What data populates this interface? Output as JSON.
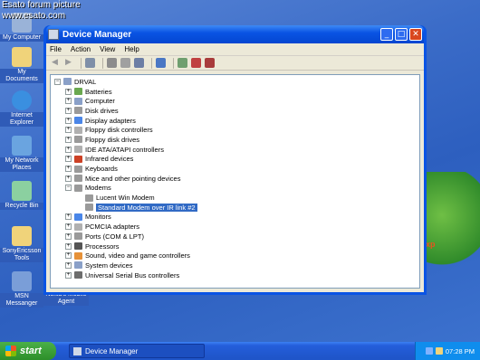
{
  "watermark": {
    "line1": "Esato forum picture",
    "line2": "www.esato.com"
  },
  "desktop": {
    "icons": [
      {
        "label": "My Computer",
        "color": "#9ab3d8"
      },
      {
        "label": "My Documents",
        "color": "#f0d37a"
      },
      {
        "label": "Internet Explorer",
        "color": "#3a8fe0"
      },
      {
        "label": "My Network Places",
        "color": "#6aa4e0"
      },
      {
        "label": "Recycle Bin",
        "color": "#8bd0a0"
      },
      {
        "label": "SonyEricsson Tools",
        "color": "#f0d37a"
      },
      {
        "label": "MSN Messanger",
        "color": "#7a9ed8"
      },
      {
        "label": "Agent",
        "label_top": "Nokia's Mobile",
        "color": "#9ab3d8"
      }
    ],
    "xp_logo": "xp"
  },
  "window": {
    "title": "Device Manager",
    "buttons": {
      "minimize": "_",
      "maximize": "□",
      "close": "✕"
    },
    "menu": [
      "File",
      "Action",
      "View",
      "Help"
    ],
    "tree": {
      "root": "DRVAL",
      "categories": [
        {
          "label": "Batteries",
          "expanded": false,
          "icon_color": "#6aa84f"
        },
        {
          "label": "Computer",
          "expanded": false,
          "icon_color": "#8aa0c8"
        },
        {
          "label": "Disk drives",
          "expanded": false,
          "icon_color": "#9a9a9a"
        },
        {
          "label": "Display adapters",
          "expanded": false,
          "icon_color": "#4a86e8"
        },
        {
          "label": "Floppy disk controllers",
          "expanded": false,
          "icon_color": "#b0b0b0"
        },
        {
          "label": "Floppy disk drives",
          "expanded": false,
          "icon_color": "#9a9a9a"
        },
        {
          "label": "IDE ATA/ATAPI controllers",
          "expanded": false,
          "icon_color": "#b0b0b0"
        },
        {
          "label": "Infrared devices",
          "expanded": false,
          "icon_color": "#cc4125"
        },
        {
          "label": "Keyboards",
          "expanded": false,
          "icon_color": "#9a9a9a"
        },
        {
          "label": "Mice and other pointing devices",
          "expanded": false,
          "icon_color": "#9a9a9a"
        },
        {
          "label": "Modems",
          "expanded": true,
          "icon_color": "#9a9a9a",
          "children": [
            {
              "label": "Lucent Win Modem",
              "selected": false
            },
            {
              "label": "Standard Modem over IR link #2",
              "selected": true
            }
          ]
        },
        {
          "label": "Monitors",
          "expanded": false,
          "icon_color": "#4a86e8"
        },
        {
          "label": "PCMCIA adapters",
          "expanded": false,
          "icon_color": "#b0b0b0"
        },
        {
          "label": "Ports (COM & LPT)",
          "expanded": false,
          "icon_color": "#9a9a9a"
        },
        {
          "label": "Processors",
          "expanded": false,
          "icon_color": "#555555"
        },
        {
          "label": "Sound, video and game controllers",
          "expanded": false,
          "icon_color": "#e69138"
        },
        {
          "label": "System devices",
          "expanded": false,
          "icon_color": "#8aa0c8"
        },
        {
          "label": "Universal Serial Bus controllers",
          "expanded": false,
          "icon_color": "#6d6d6d"
        }
      ]
    }
  },
  "taskbar": {
    "start_label": "start",
    "task_label": "Device Manager",
    "clock": "07:28 PM"
  }
}
